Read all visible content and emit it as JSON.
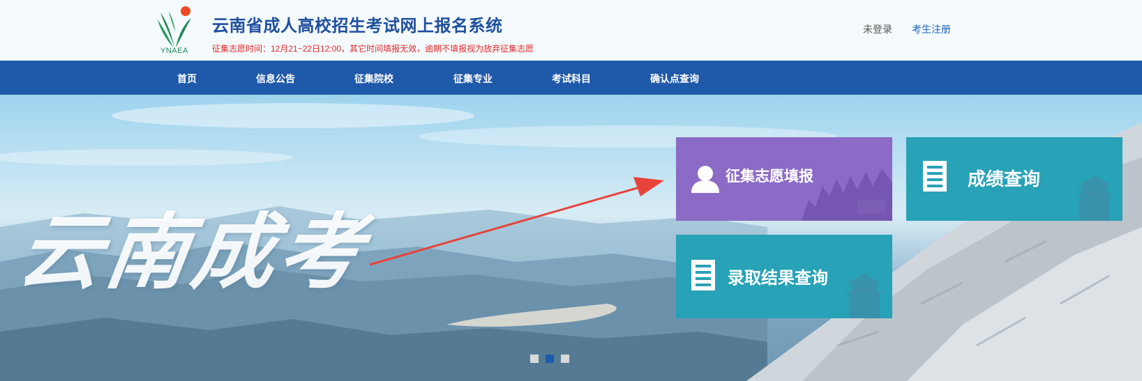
{
  "header": {
    "logo_text": "YNAEA",
    "title": "云南省成人高校招生考试网上报名系统",
    "notice": "征集志愿时间：12月21~22日12:00，其它时间填报无效，逾期不填报视为放弃征集志愿",
    "login_status": "未登录",
    "register_label": "考生注册"
  },
  "nav": {
    "items": [
      {
        "label": "首页"
      },
      {
        "label": "信息公告"
      },
      {
        "label": "征集院校"
      },
      {
        "label": "征集专业"
      },
      {
        "label": "考试科目"
      },
      {
        "label": "确认点查询"
      }
    ]
  },
  "banner": {
    "calligraphy": "云南成考",
    "tiles": [
      {
        "label": "征集志愿填报",
        "icon": "user-icon"
      },
      {
        "label": "成绩查询",
        "icon": "document-icon"
      },
      {
        "label": "录取结果查询",
        "icon": "document-icon"
      }
    ],
    "carousel_active_index": 1
  },
  "colors": {
    "nav_bg": "#1f59aa",
    "title": "#1f4f9e",
    "notice": "#e02a2a",
    "tile_purple": "#8b6bc6",
    "tile_teal": "#27a2b7",
    "arrow": "#e8433a"
  }
}
